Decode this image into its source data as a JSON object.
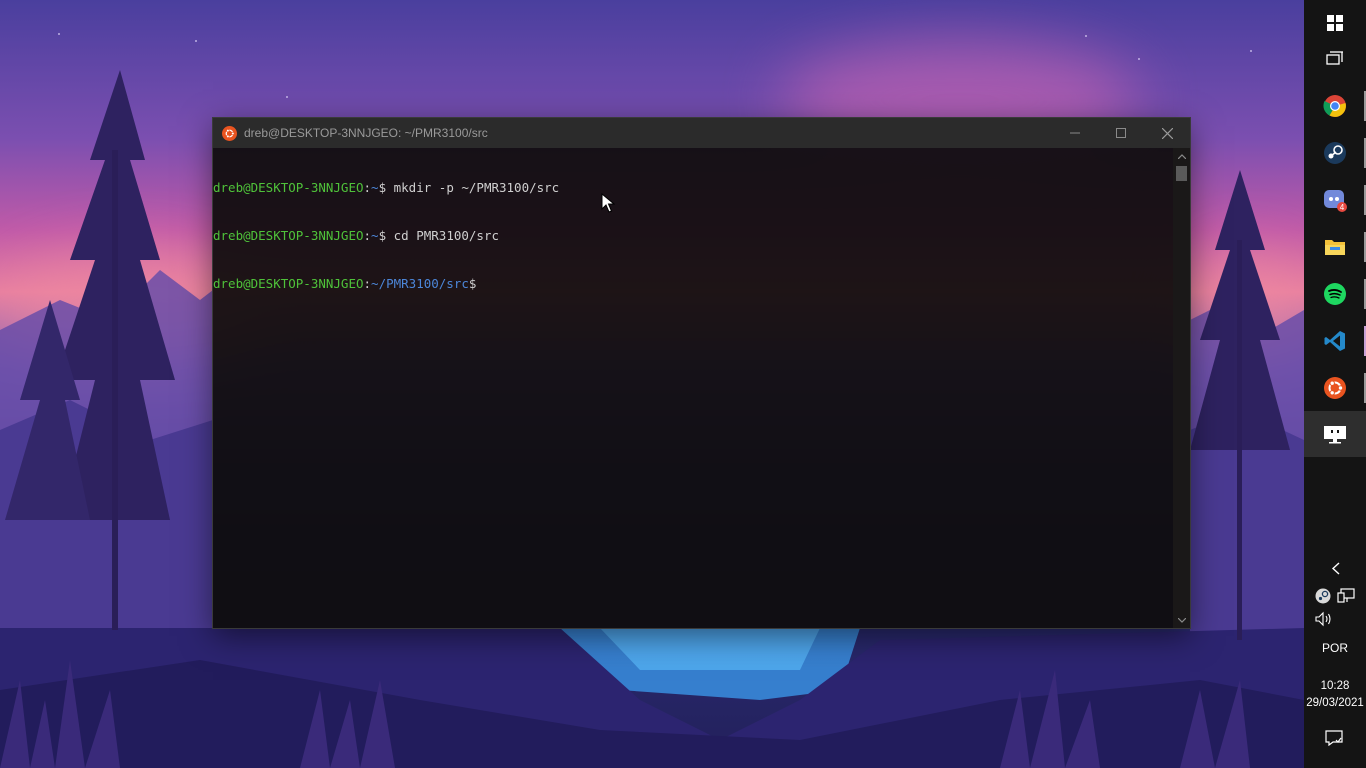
{
  "window": {
    "title": "dreb@DESKTOP-3NNJGEO: ~/PMR3100/src",
    "minimize_label": "—",
    "maximize_label": "☐",
    "close_label": "✕"
  },
  "terminal": {
    "lines": [
      {
        "user": "dreb@DESKTOP-3NNJGEO",
        "sep": ":",
        "path": "~",
        "prompt": "$",
        "command": " mkdir -p ~/PMR3100/src"
      },
      {
        "user": "dreb@DESKTOP-3NNJGEO",
        "sep": ":",
        "path": "~",
        "prompt": "$",
        "command": " cd PMR3100/src"
      },
      {
        "user": "dreb@DESKTOP-3NNJGEO",
        "sep": ":",
        "path": "~/PMR3100/src",
        "prompt": "$",
        "command": ""
      }
    ]
  },
  "taskbar": {
    "apps": [
      {
        "name": "start-icon"
      },
      {
        "name": "task-view-icon"
      },
      {
        "name": "chrome-icon"
      },
      {
        "name": "steam-icon"
      },
      {
        "name": "discord-icon",
        "badge": "4"
      },
      {
        "name": "file-explorer-icon"
      },
      {
        "name": "spotify-icon"
      },
      {
        "name": "vscode-icon"
      },
      {
        "name": "ubuntu-icon"
      },
      {
        "name": "desktop-icon"
      }
    ],
    "tray": {
      "show_hidden_label": "‹",
      "language": "POR",
      "time": "10:28",
      "date": "29/03/2021"
    }
  },
  "colors": {
    "user_green": "#4fc23a",
    "path_blue": "#4c86d8",
    "ubuntu_orange": "#e95420"
  }
}
